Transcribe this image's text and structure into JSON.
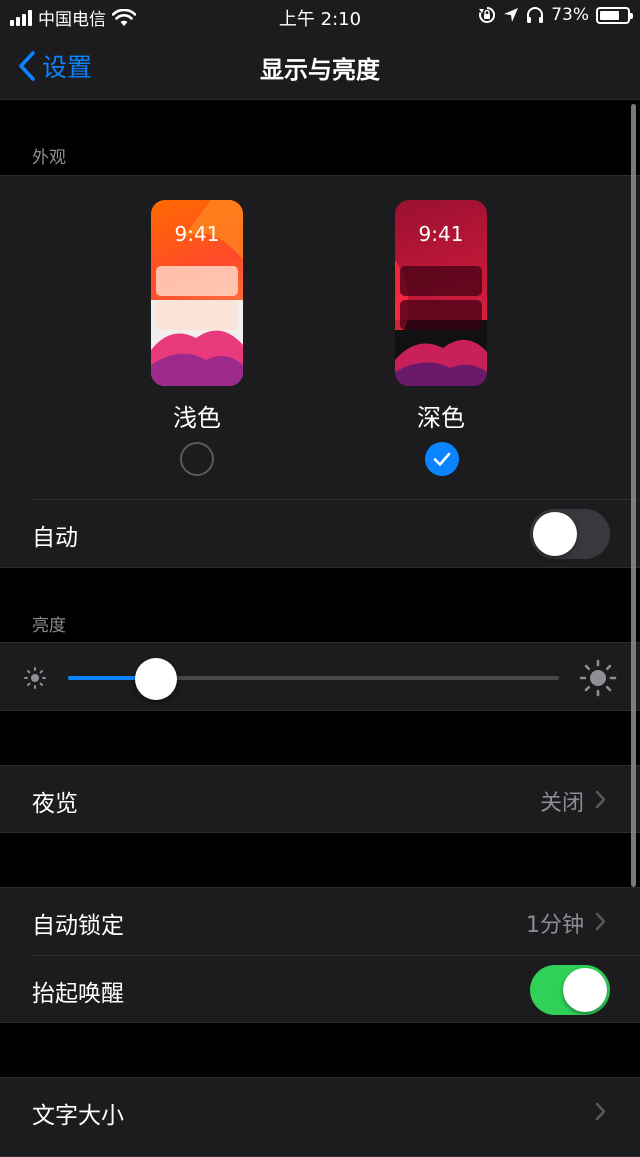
{
  "status_bar": {
    "carrier": "中国电信",
    "time": "上午 2:10",
    "battery": "73%",
    "battery_level": 0.73
  },
  "nav": {
    "back_label": "设置",
    "title": "显示与亮度"
  },
  "appearance": {
    "header": "外观",
    "light": {
      "label": "浅色",
      "time": "9:41",
      "selected": false
    },
    "dark": {
      "label": "深色",
      "time": "9:41",
      "selected": true
    },
    "auto_label": "自动",
    "auto_on": false
  },
  "brightness": {
    "header": "亮度",
    "level": 0.18
  },
  "night_shift": {
    "label": "夜览",
    "value": "关闭"
  },
  "auto_lock": {
    "label": "自动锁定",
    "value": "1分钟"
  },
  "raise_to_wake": {
    "label": "抬起唤醒",
    "on": true
  },
  "text_size": {
    "label": "文字大小"
  },
  "colors": {
    "accent": "#0a84ff",
    "toggle_on": "#30d158",
    "background": "#000000",
    "cell": "#1c1c1e",
    "secondary_text": "#8d8d93"
  },
  "icons": [
    "signal-icon",
    "wifi-icon",
    "rotation-lock-icon",
    "location-icon",
    "headphones-icon",
    "battery-icon",
    "back-chevron-icon",
    "checkmark-icon",
    "chevron-right-icon",
    "brightness-low-icon",
    "brightness-high-icon"
  ]
}
